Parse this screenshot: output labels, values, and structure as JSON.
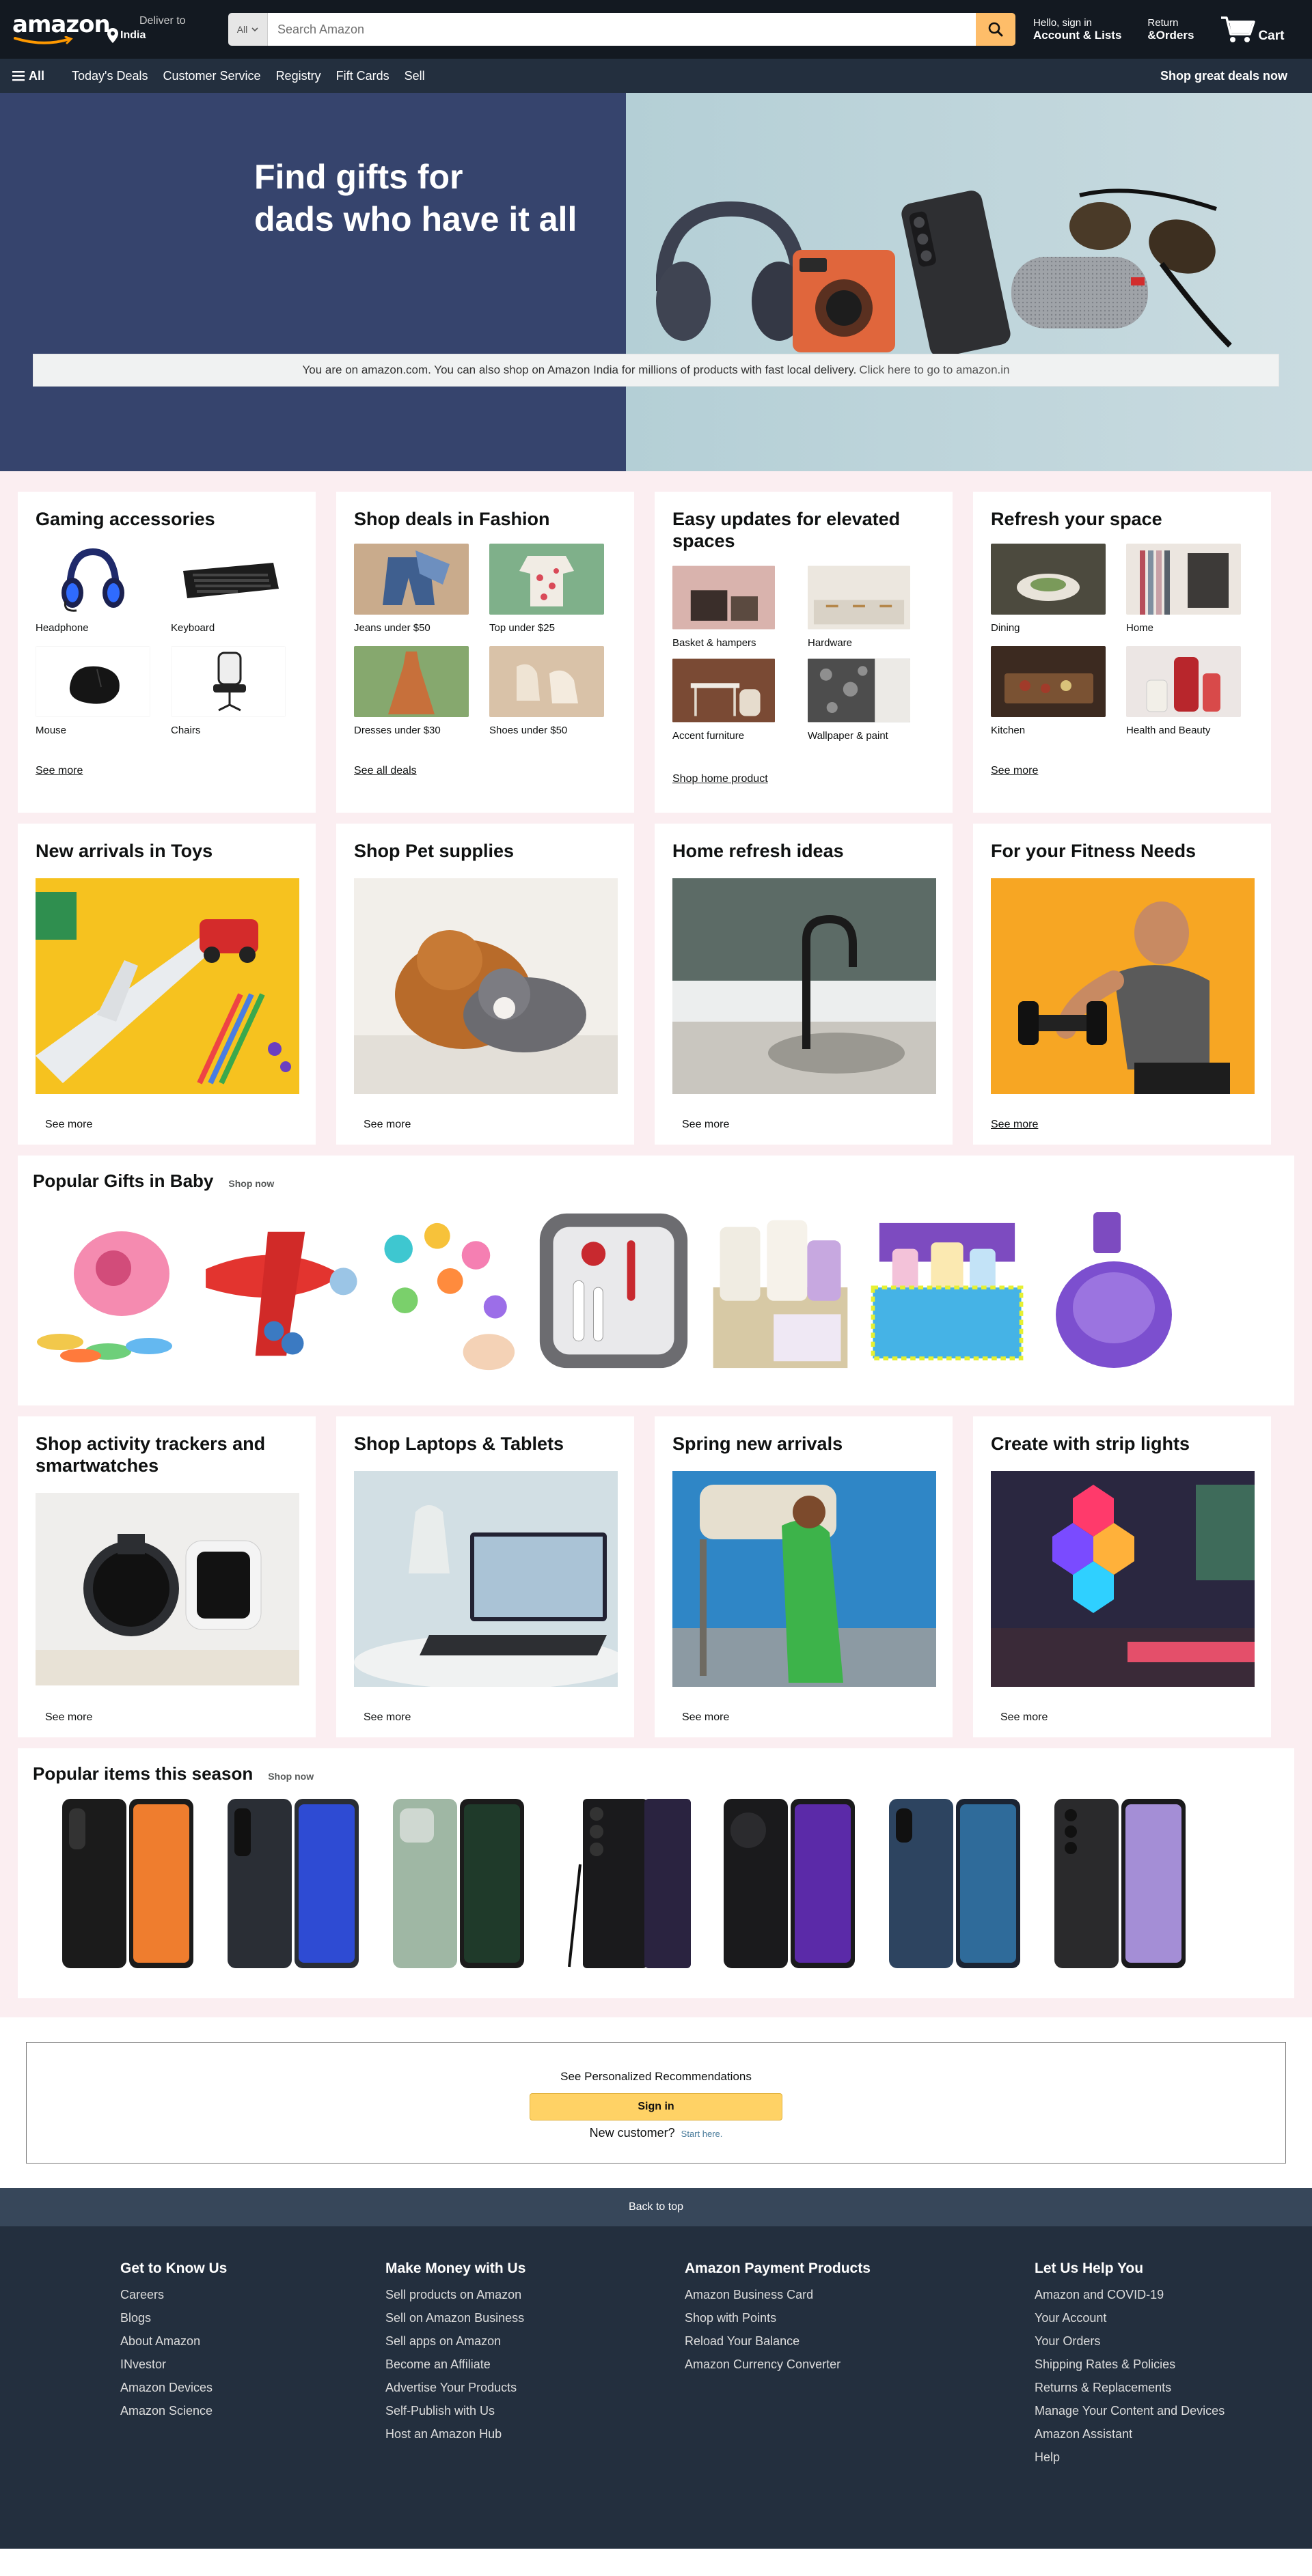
{
  "header": {
    "logo": "amazon",
    "deliver_label": "Deliver to",
    "deliver_location": "India",
    "search_category": "All",
    "search_placeholder": "Search Amazon",
    "account_line1": "Hello, sign in",
    "account_line2": "Account & Lists",
    "orders_line1": "Return",
    "orders_line2": "&Orders",
    "cart_label": "Cart"
  },
  "subnav": {
    "all_label": "All",
    "items": [
      "Today's Deals",
      "Customer Service",
      "Registry",
      "Fift Cards",
      "Sell"
    ],
    "promo": "Shop great deals now"
  },
  "hero": {
    "title_line1": "Find gifts for",
    "title_line2": "dads who have it all",
    "banner_text": "You are on amazon.com. You can also shop on Amazon India for millions of products with fast local delivery.",
    "banner_link": "Click here to go to amazon.in"
  },
  "row1": [
    {
      "title": "Gaming accessories",
      "tiles": [
        "Headphone",
        "Keyboard",
        "Mouse",
        "Chairs"
      ],
      "link": "See more"
    },
    {
      "title": "Shop deals in Fashion",
      "tiles": [
        "Jeans under $50",
        "Top under $25",
        "Dresses under $30",
        "Shoes under $50"
      ],
      "link": "See all deals"
    },
    {
      "title": "Easy updates for elevated spaces",
      "tiles": [
        "Basket & hampers",
        "Hardware",
        "Accent furniture",
        "Wallpaper & paint"
      ],
      "link": "Shop home product"
    },
    {
      "title": "Refresh your space",
      "tiles": [
        "Dining",
        "Home",
        "Kitchen",
        "Health and Beauty"
      ],
      "link": "See more"
    }
  ],
  "row2": [
    {
      "title": "New arrivals in Toys",
      "link": "See more"
    },
    {
      "title": "Shop Pet supplies",
      "link": "See more"
    },
    {
      "title": "Home refresh ideas",
      "link": "See more"
    },
    {
      "title": "For your Fitness Needs",
      "link": "See more"
    }
  ],
  "baby_strip": {
    "title": "Popular Gifts in Baby",
    "link": "Shop now"
  },
  "row3": [
    {
      "title": "Shop activity trackers and smartwatches",
      "link": "See more"
    },
    {
      "title": "Shop Laptops & Tablets",
      "link": "See more"
    },
    {
      "title": "Spring new arrivals",
      "link": "See more"
    },
    {
      "title": "Create with strip lights",
      "link": "See more"
    }
  ],
  "season_strip": {
    "title": "Popular items this season",
    "link": "Shop now"
  },
  "signin": {
    "recommend": "See Personalized Recommendations",
    "button": "Sign in",
    "new_customer": "New customer?",
    "start_here": "Start here."
  },
  "footer": {
    "back_to_top": "Back to top",
    "columns": [
      {
        "title": "Get to Know Us",
        "links": [
          "Careers",
          "Blogs",
          "About Amazon",
          "INvestor",
          "Amazon Devices",
          "Amazon Science"
        ]
      },
      {
        "title": "Make Money with Us",
        "links": [
          "Sell products on Amazon",
          "Sell on Amazon Business",
          "Sell apps on Amazon",
          "Become an Affiliate",
          "Advertise Your Products",
          "Self-Publish with Us",
          "Host an Amazon Hub"
        ]
      },
      {
        "title": "Amazon Payment Products",
        "links": [
          "Amazon Business Card",
          "Shop with Points",
          "Reload Your Balance",
          "Amazon Currency Converter"
        ]
      },
      {
        "title": "Let Us Help You",
        "links": [
          "Amazon and COVID-19",
          "Your Account",
          "Your Orders",
          "Shipping Rates & Policies",
          "Returns & Replacements",
          "Manage Your Content and Devices",
          "Amazon Assistant",
          "Help"
        ]
      }
    ]
  },
  "colors": {
    "nav_dark": "#131921",
    "nav_sub": "#232f3e",
    "hero_blue": "#36446d",
    "search_button": "#febd69",
    "signin_button": "#ffd265",
    "page_bg": "#fbeef1"
  },
  "icons": [
    "location-pin-icon",
    "chevron-down-icon",
    "search-icon",
    "cart-icon",
    "hamburger-icon"
  ]
}
